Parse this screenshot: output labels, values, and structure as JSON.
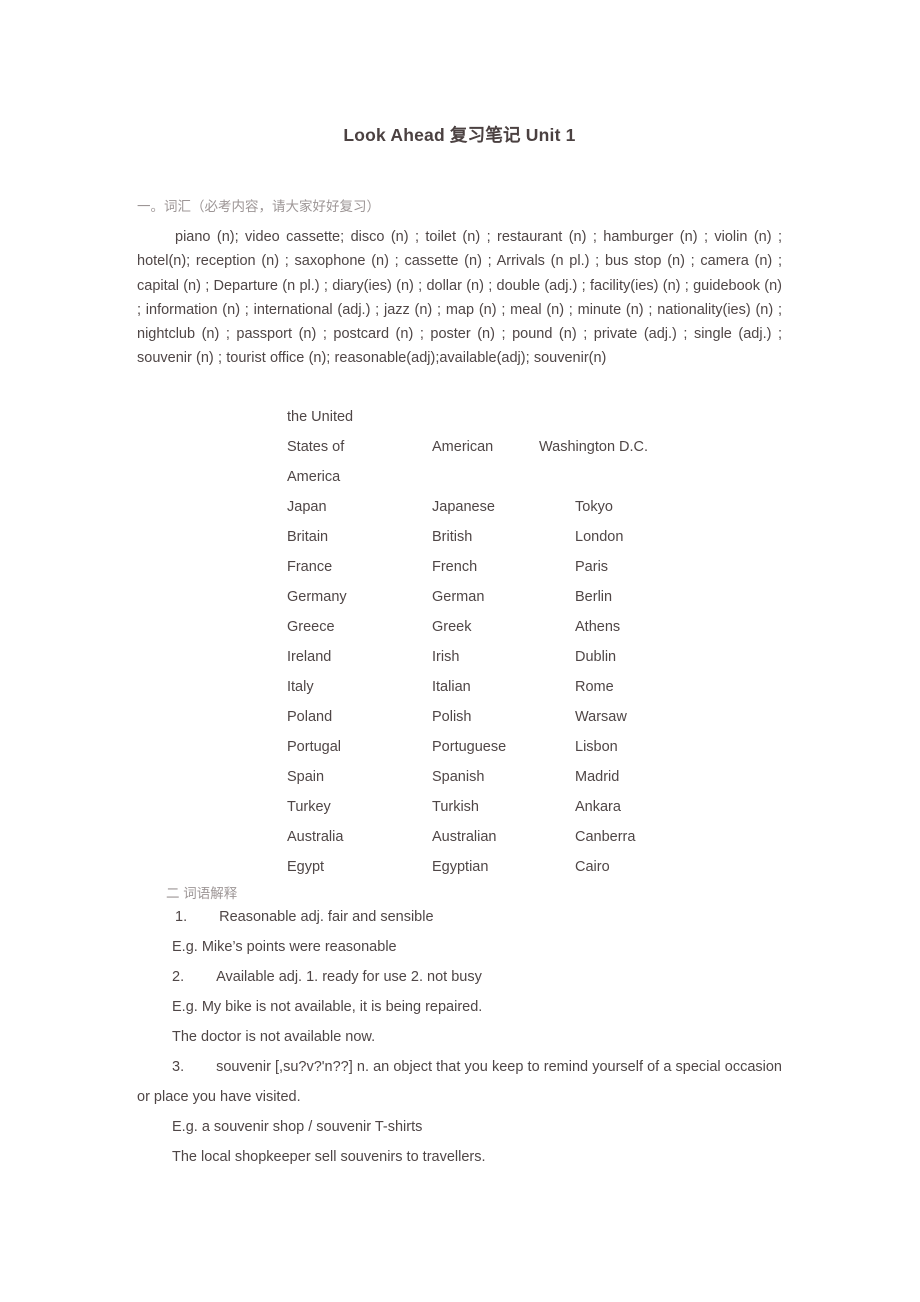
{
  "document": {
    "title": "Look Ahead 复习笔记 Unit 1"
  },
  "section_vocabulary": {
    "heading": "一。词汇（必考内容，请大家好好复习）",
    "words_paragraph": "piano (n); video cassette; disco (n) ; toilet (n) ; restaurant (n) ; hamburger (n) ; violin (n) ; hotel(n); reception (n) ; saxophone (n) ; cassette (n) ;  Arrivals (n pl.) ; bus stop (n) ; camera (n) ; capital (n) ; Departure (n pl.) ; diary(ies) (n) ; dollar (n) ; double (adj.) ; facility(ies) (n) ; guidebook (n) ; information (n) ; international (adj.) ; jazz (n) ; map (n) ; meal (n) ; minute (n) ; nationality(ies) (n) ; nightclub (n) ; passport (n) ; postcard (n) ; poster (n) ; pound (n) ; private (adj.) ; single (adj.) ; souvenir (n) ; tourist office (n); reasonable(adj);available(adj); souvenir(n)"
  },
  "country_table": {
    "rows": [
      {
        "country": "the United States of America",
        "nationality": "American",
        "capital": "Washington D.C."
      },
      {
        "country": "Japan",
        "nationality": "Japanese",
        "capital": "Tokyo"
      },
      {
        "country": "Britain",
        "nationality": "British",
        "capital": "London"
      },
      {
        "country": "France",
        "nationality": "French",
        "capital": "Paris"
      },
      {
        "country": "Germany",
        "nationality": "German",
        "capital": "Berlin"
      },
      {
        "country": "Greece",
        "nationality": "Greek",
        "capital": "Athens"
      },
      {
        "country": "Ireland",
        "nationality": "Irish",
        "capital": "Dublin"
      },
      {
        "country": "Italy",
        "nationality": "Italian",
        "capital": "Rome"
      },
      {
        "country": "Poland",
        "nationality": "Polish",
        "capital": "Warsaw"
      },
      {
        "country": "Portugal",
        "nationality": "Portuguese",
        "capital": "Lisbon"
      },
      {
        "country": "Spain",
        "nationality": "Spanish",
        "capital": "Madrid"
      },
      {
        "country": "Turkey",
        "nationality": "Turkish",
        "capital": "Ankara"
      },
      {
        "country": "Australia",
        "nationality": "Australian",
        "capital": "Canberra"
      },
      {
        "country": "Egypt",
        "nationality": "Egyptian",
        "capital": "Cairo"
      }
    ]
  },
  "section_definitions": {
    "heading": "二  词语解释",
    "item1_num": "1.",
    "item1_text": "Reasonable  adj. fair and sensible",
    "item1_example": "E.g. Mike’s points were reasonable",
    "item2_num": "2.",
    "item2_text": "Available   adj. 1. ready for use   2. not busy",
    "item2_example1": "E.g. My bike is not available, it is being repaired.",
    "item2_example2": "The doctor is not available now.",
    "item3_num": "3.",
    "item3_text": "souvenir [,su?v?'n??]  n.  an object that you keep to remind yourself of a special occasion or place you have visited.",
    "item3_example1": "E.g. a souvenir shop / souvenir T-shirts",
    "item3_example2": "The local shopkeeper sell souvenirs to travellers."
  }
}
